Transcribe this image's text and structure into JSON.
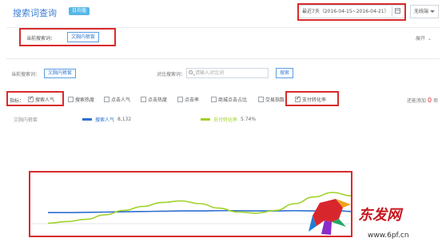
{
  "header": {
    "title": "搜索词查询",
    "badge": "日均值",
    "date_range": "最近7天（2016-04-15~2016-04-21）",
    "device": "无线端"
  },
  "current_search": {
    "label": "当前搜索词：",
    "tag": "文胸内裤套",
    "expand": "展开"
  },
  "search_row": {
    "current_label": "当前搜索词：",
    "current_tag": "文胸内裤套",
    "compare_label": "对比搜索词：",
    "compare_placeholder": "请输入对比词",
    "search_button": "搜索"
  },
  "metrics": {
    "label": "指标：",
    "items": [
      {
        "label": "搜索人气",
        "checked": true
      },
      {
        "label": "搜索热度",
        "checked": false
      },
      {
        "label": "点击人气",
        "checked": false
      },
      {
        "label": "点击热度",
        "checked": false
      },
      {
        "label": "点击率",
        "checked": false
      },
      {
        "label": "商城点击占比",
        "checked": false
      },
      {
        "label": "交易指数",
        "checked": false
      },
      {
        "label": "支付转化率",
        "checked": true
      }
    ],
    "added_text": "还能添加",
    "added_count": "0",
    "added_unit": "项"
  },
  "chart_meta": {
    "keyword": "文胸内裤套",
    "legend": [
      {
        "name": "搜索人气",
        "value": "8,132",
        "color": "#2f6fd0"
      },
      {
        "name": "支付转化率",
        "value": "5.74%",
        "color": "#9fd22a"
      }
    ]
  },
  "chart_data": {
    "type": "line",
    "title": "",
    "xlabel": "",
    "ylabel": "",
    "series": [
      {
        "name": "搜索人气",
        "color": "#2f6fd0",
        "values": [
          0.34,
          0.34,
          0.345,
          0.35,
          0.355,
          0.36,
          0.365,
          0.37,
          0.37,
          0.375,
          0.375,
          0.37,
          0.37,
          0.375,
          0.37,
          0.38,
          0.36
        ]
      },
      {
        "name": "支付转化率",
        "color": "#9fd22a",
        "values": [
          0.15,
          0.18,
          0.22,
          0.3,
          0.38,
          0.45,
          0.52,
          0.55,
          0.5,
          0.42,
          0.35,
          0.33,
          0.38,
          0.5,
          0.62,
          0.7,
          0.64
        ]
      }
    ]
  },
  "watermark": {
    "brand": "东发网",
    "url": "www.6pf.cn"
  }
}
